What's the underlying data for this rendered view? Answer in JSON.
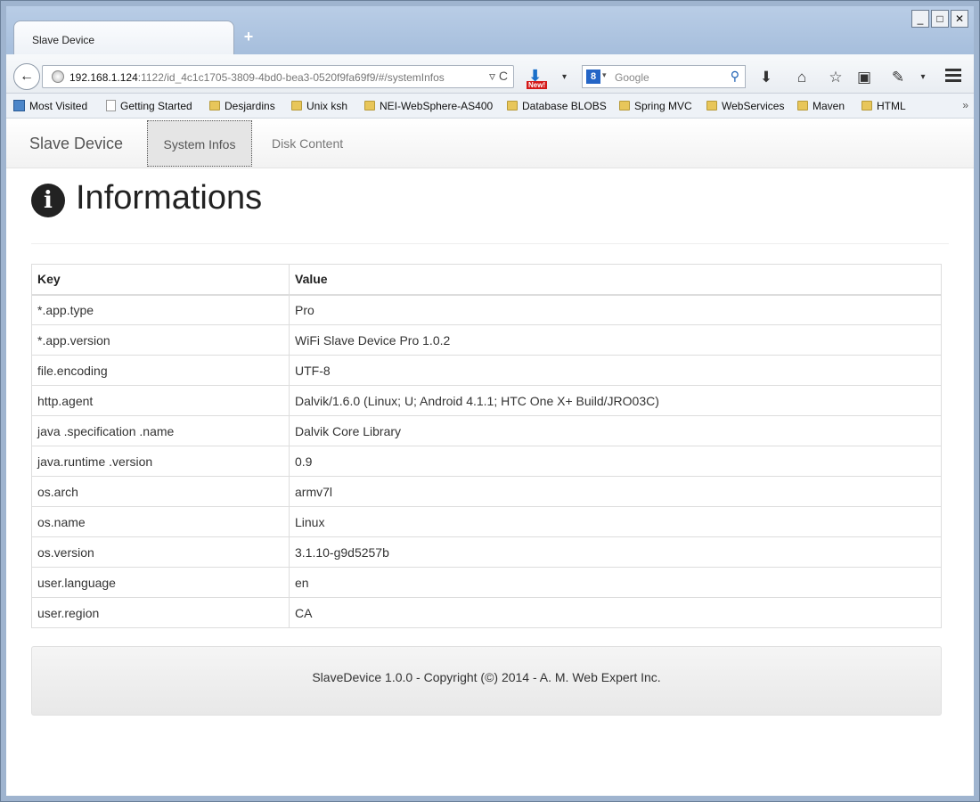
{
  "browser": {
    "tab_title": "Slave Device",
    "url_host": "192.168.1.124",
    "url_rest": ":1122/id_4c1c1705-3809-4bd0-bea3-0520f9fa69f9/#/systemInfos",
    "download_badge": "New!",
    "search_placeholder": "Google",
    "search_engine_letter": "8",
    "bookmarks": [
      {
        "label": "Most Visited",
        "icon": "most-visited-icon"
      },
      {
        "label": "Getting Started",
        "icon": "page-icon"
      },
      {
        "label": "Desjardins",
        "icon": "folder-icon"
      },
      {
        "label": "Unix ksh",
        "icon": "folder-icon"
      },
      {
        "label": "NEI-WebSphere-AS400",
        "icon": "folder-icon"
      },
      {
        "label": "Database BLOBS",
        "icon": "folder-icon"
      },
      {
        "label": "Spring MVC",
        "icon": "folder-icon"
      },
      {
        "label": "WebServices",
        "icon": "folder-icon"
      },
      {
        "label": "Maven",
        "icon": "folder-icon"
      },
      {
        "label": "HTML",
        "icon": "folder-icon"
      }
    ]
  },
  "app": {
    "brand": "Slave Device",
    "nav": [
      "System Infos",
      "Disk Content"
    ],
    "heading": "Informations",
    "info_icon_glyph": "i",
    "table": {
      "headers": [
        "Key",
        "Value"
      ],
      "rows": [
        [
          "*.app.type",
          "Pro"
        ],
        [
          "*.app.version",
          "WiFi Slave Device Pro 1.0.2"
        ],
        [
          "file.encoding",
          "UTF-8"
        ],
        [
          "http.agent",
          "Dalvik/1.6.0 (Linux; U; Android 4.1.1; HTC One X+ Build/JRO03C)"
        ],
        [
          "java .specification .name",
          "Dalvik Core Library"
        ],
        [
          "java.runtime .version",
          "0.9"
        ],
        [
          "os.arch",
          "armv7l"
        ],
        [
          "os.name",
          "Linux"
        ],
        [
          "os.version",
          "3.1.10-g9d5257b"
        ],
        [
          "user.language",
          "en"
        ],
        [
          "user.region",
          "CA"
        ]
      ]
    },
    "footer": "SlaveDevice 1.0.0 - Copyright (©) 2014 - A. M. Web Expert Inc."
  }
}
